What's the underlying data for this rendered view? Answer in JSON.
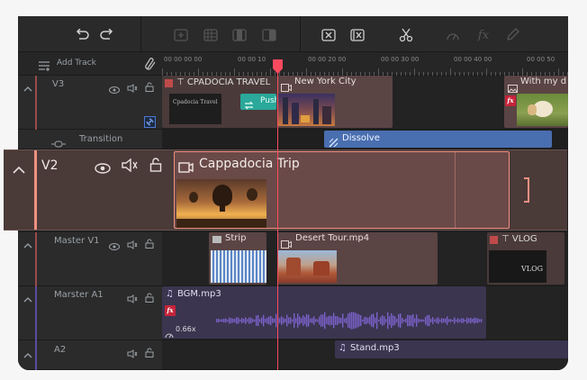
{
  "toolbar": {
    "icons": [
      "undo-icon",
      "redo-icon",
      "add-clip-icon",
      "mosaic-icon",
      "split-view-icon",
      "crop-icon",
      "delete-clip-icon",
      "delete-gap-icon",
      "cut-icon",
      "speed-icon",
      "fx-icon",
      "pen-icon"
    ],
    "fx_label": "fx"
  },
  "ruler": {
    "add_track_label": "Add Track",
    "ticks": [
      "00 00 00 00",
      "00 00 10",
      "00 00 20 00",
      "00 00 30 00",
      "00 00 40 00",
      "00 00 50"
    ]
  },
  "tracks": {
    "v3": {
      "name": "V3"
    },
    "transition": {
      "name": "Transition"
    },
    "v2": {
      "name": "V2"
    },
    "master_v1": {
      "name": "Master V1"
    },
    "master_a1": {
      "name": "Marster A1"
    },
    "a2": {
      "name": "A2"
    }
  },
  "clips": {
    "cpadocia": {
      "label": "CPADOCIA TRAVEL",
      "thumb_text": "Cpadocia Travel"
    },
    "push": {
      "label": "Push"
    },
    "newyork": {
      "label": "New York City"
    },
    "withmy": {
      "label": "With my d"
    },
    "dissolve": {
      "label": "Dissolve"
    },
    "cappadocia": {
      "label": "Cappadocia Trip"
    },
    "strip": {
      "label": "Strip"
    },
    "desert": {
      "label": "Desert Tour.mp4"
    },
    "vlog": {
      "label": "VLOG",
      "thumb_text": "VLOG"
    },
    "bgm": {
      "label": "BGM.mp3",
      "speed": "0.66x"
    },
    "stand": {
      "label": "Stand.mp3"
    }
  },
  "colors": {
    "playhead": "#ff4a5e",
    "video_clip": "#5a4444",
    "transition_clip": "#4a6fb0",
    "audio_clip": "#3b3550",
    "push_clip": "#2aa89a",
    "v2_clip": "#6a4a48",
    "v2_accent": "#f09080"
  }
}
